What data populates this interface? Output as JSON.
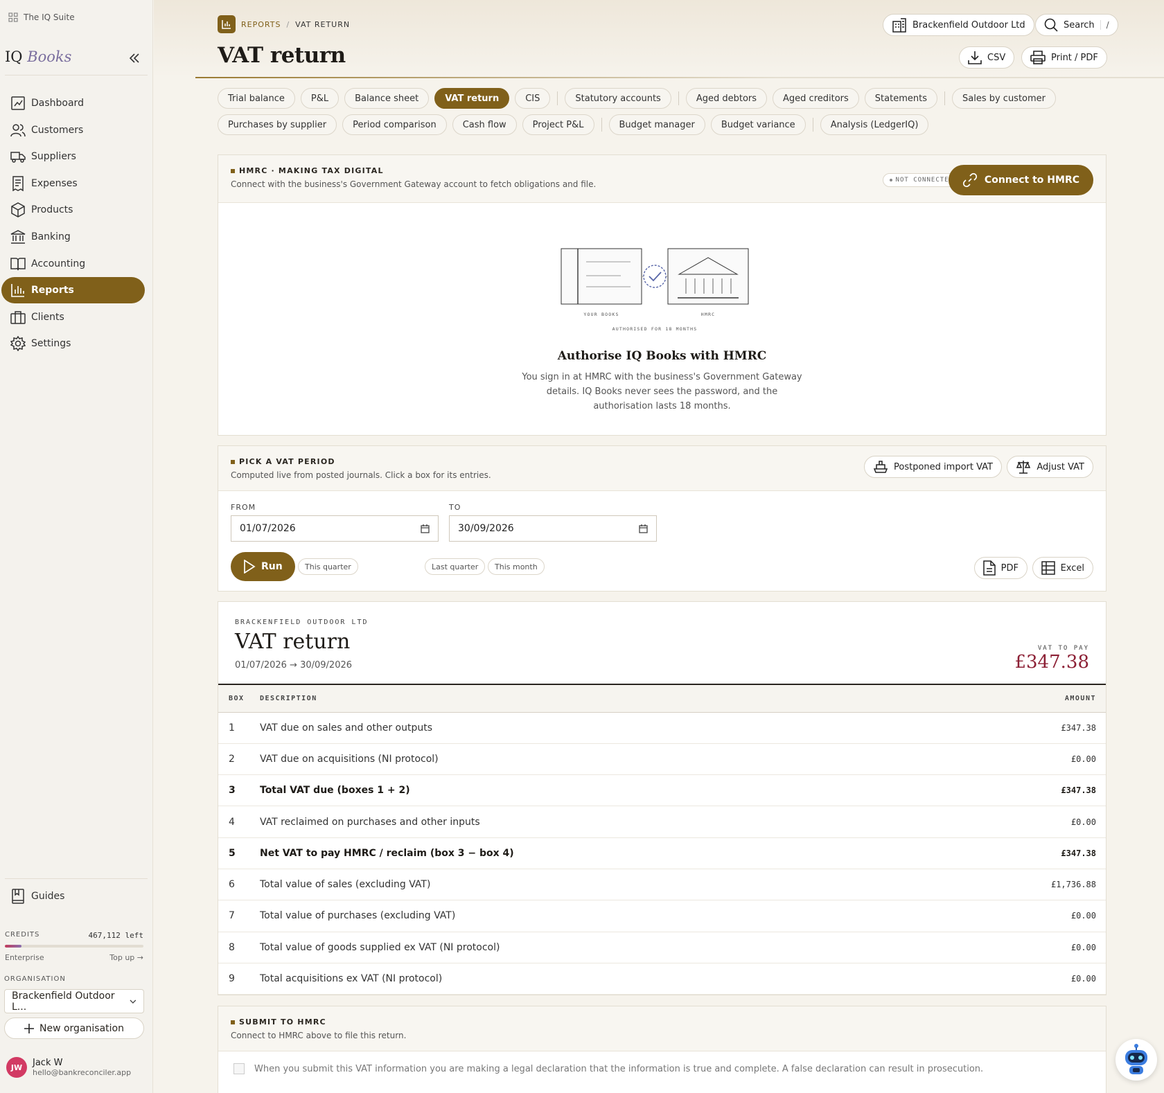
{
  "sidebar": {
    "suite_label": "The IQ Suite",
    "logo_iq": "IQ",
    "logo_books": "Books",
    "nav": [
      {
        "label": "Dashboard",
        "icon": "dashboard-icon"
      },
      {
        "label": "Customers",
        "icon": "users-icon"
      },
      {
        "label": "Suppliers",
        "icon": "truck-icon"
      },
      {
        "label": "Expenses",
        "icon": "receipt-icon"
      },
      {
        "label": "Products",
        "icon": "box-icon"
      },
      {
        "label": "Banking",
        "icon": "bank-icon"
      },
      {
        "label": "Accounting",
        "icon": "book-icon"
      },
      {
        "label": "Reports",
        "icon": "chart-icon",
        "active": true
      },
      {
        "label": "Clients",
        "icon": "briefcase-icon"
      },
      {
        "label": "Settings",
        "icon": "gear-icon"
      }
    ],
    "guides_label": "Guides",
    "credits": {
      "label": "CREDITS",
      "left": "467,112 left",
      "plan": "Enterprise",
      "top_up": "Top up →",
      "usage_fraction": 0.12
    },
    "organisation_label": "ORGANISATION",
    "organisation_value": "Brackenfield Outdoor L...",
    "new_org_label": "New organisation",
    "user": {
      "initials": "JW",
      "name": "Jack W",
      "email": "hello@bankreconciler.app"
    }
  },
  "header": {
    "crumb_section": "REPORTS",
    "crumb_sep": "/",
    "crumb_page": "VAT RETURN",
    "title": "VAT return",
    "company_button": "Brackenfield Outdoor Ltd",
    "search_label": "Search",
    "search_shortcut": "/",
    "csv_label": "CSV",
    "print_label": "Print / PDF"
  },
  "tabs": {
    "row1": [
      "Trial balance",
      "P&L",
      "Balance sheet",
      "VAT return",
      "CIS",
      "|",
      "Statutory accounts",
      "|",
      "Aged debtors",
      "Aged creditors",
      "Statements",
      "|",
      "Sales by customer"
    ],
    "row2": [
      "Purchases by supplier",
      "Period comparison",
      "Cash flow",
      "Project P&L",
      "|",
      "Budget manager",
      "Budget variance",
      "|",
      "Analysis (LedgerIQ)"
    ],
    "active": "VAT return"
  },
  "hmrc": {
    "label": "HMRC · MAKING TAX DIGITAL",
    "sub": "Connect with the business's Government Gateway account to fetch obligations and file.",
    "status": "NOT CONNECTED",
    "connect_label": "Connect to HMRC",
    "illus_left": "YOUR BOOKS",
    "illus_right": "HMRC",
    "illus_caption": "AUTHORISED FOR 18 MONTHS",
    "auth_title": "Authorise IQ Books with HMRC",
    "auth_text": "You sign in at HMRC with the business's Government Gateway details. IQ Books never sees the password, and the authorisation lasts 18 months."
  },
  "period": {
    "label": "PICK A VAT PERIOD",
    "sub": "Computed live from posted journals. Click a box for its entries.",
    "postponed_label": "Postponed import VAT",
    "adjust_label": "Adjust VAT",
    "from_label": "FROM",
    "from_value": "01/07/2026",
    "to_label": "TO",
    "to_value": "30/09/2026",
    "run_label": "Run",
    "presets": [
      "This quarter",
      "Last quarter",
      "This month"
    ],
    "pdf_label": "PDF",
    "excel_label": "Excel"
  },
  "report": {
    "company": "BRACKENFIELD OUTDOOR LTD",
    "title": "VAT return",
    "period": "01/07/2026 → 30/09/2026",
    "vat_to_pay_label": "VAT TO PAY",
    "vat_to_pay": "£347.38",
    "columns": {
      "box": "BOX",
      "description": "DESCRIPTION",
      "amount": "AMOUNT"
    },
    "rows": [
      {
        "box": "1",
        "description": "VAT due on sales and other outputs",
        "amount": "£347.38",
        "bold": false
      },
      {
        "box": "2",
        "description": "VAT due on acquisitions (NI protocol)",
        "amount": "£0.00",
        "bold": false
      },
      {
        "box": "3",
        "description": "Total VAT due (boxes 1 + 2)",
        "amount": "£347.38",
        "bold": true
      },
      {
        "box": "4",
        "description": "VAT reclaimed on purchases and other inputs",
        "amount": "£0.00",
        "bold": false
      },
      {
        "box": "5",
        "description": "Net VAT to pay HMRC / reclaim (box 3 − box 4)",
        "amount": "£347.38",
        "bold": true
      },
      {
        "box": "6",
        "description": "Total value of sales (excluding VAT)",
        "amount": "£1,736.88",
        "bold": false
      },
      {
        "box": "7",
        "description": "Total value of purchases (excluding VAT)",
        "amount": "£0.00",
        "bold": false
      },
      {
        "box": "8",
        "description": "Total value of goods supplied ex VAT (NI protocol)",
        "amount": "£0.00",
        "bold": false
      },
      {
        "box": "9",
        "description": "Total acquisitions ex VAT (NI protocol)",
        "amount": "£0.00",
        "bold": false
      }
    ]
  },
  "submit": {
    "label": "SUBMIT TO HMRC",
    "sub": "Connect to HMRC above to file this return.",
    "declaration": "When you submit this VAT information you are making a legal declaration that the information is true and complete. A false declaration can result in prosecution."
  },
  "colors": {
    "accent": "#80601a",
    "vat_amount": "#8c2035",
    "avatar": "#d23a63"
  }
}
